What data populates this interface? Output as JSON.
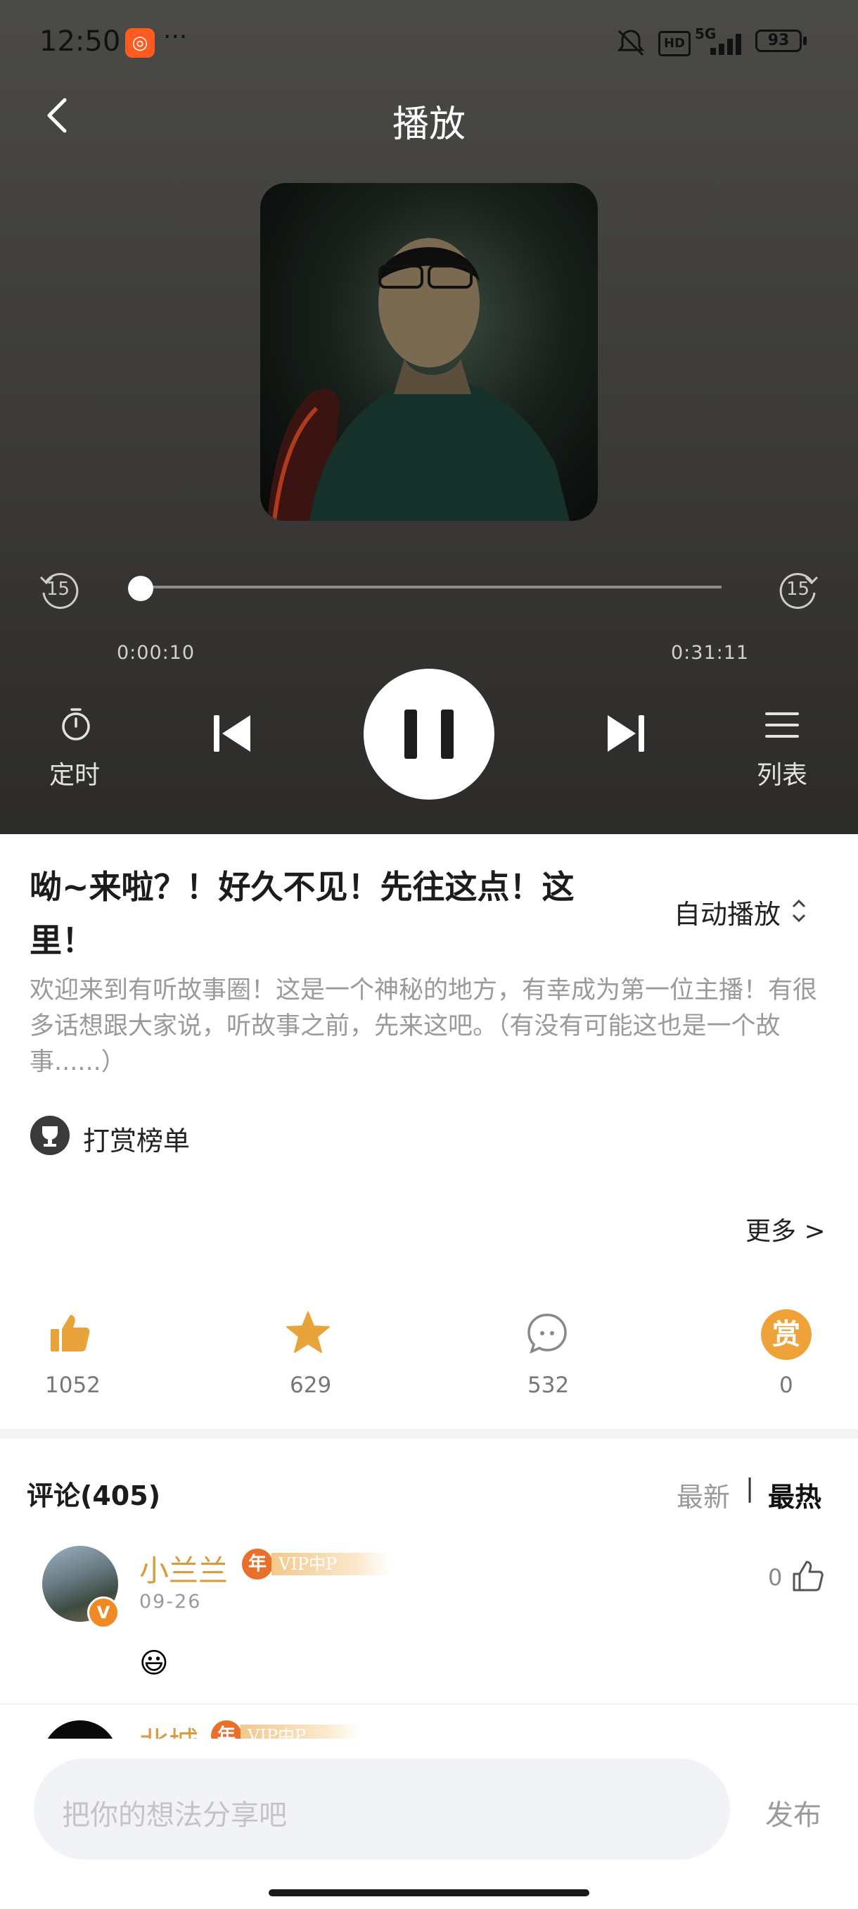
{
  "status_bar": {
    "time": "12:50",
    "ellipsis": "···",
    "battery": "93",
    "network": "5G",
    "hd": "HD"
  },
  "header": {
    "title": "播放"
  },
  "player": {
    "current_time": "0:00:10",
    "total_time": "0:31:11",
    "progress": 0.005,
    "rewind_label": "15",
    "forward_label": "15",
    "timer_label": "定时",
    "list_label": "列表"
  },
  "episode": {
    "title": "呦~来啦？！好久不见！先往这点！这里！",
    "autoplay_label": "自动播放",
    "description": "欢迎来到有听故事圈！这是一个神秘的地方，有幸成为第一位主播！有很多话想跟大家说，听故事之前，先来这吧。（有没有可能这也是一个故事......）",
    "reward_board_label": "打赏榜单",
    "more_label": "更多 >"
  },
  "stats": {
    "likes": "1052",
    "favorites": "629",
    "comments": "532",
    "rewards": "0",
    "reward_icon_text": "赏"
  },
  "comments": {
    "header": "评论(405)",
    "sort_newest": "最新",
    "sort_separator": "|",
    "sort_hottest": "最热",
    "items": [
      {
        "username": "小兰兰",
        "year_badge": "年",
        "vip_badge": "VIP中P",
        "date": "09-26",
        "like_count": "0",
        "content": "😃",
        "verified": "V"
      },
      {
        "username": "北城",
        "year_badge": "年",
        "vip_badge": "VIP中P"
      }
    ]
  },
  "composer": {
    "placeholder": "把你的想法分享吧",
    "publish_label": "发布"
  },
  "colors": {
    "accent": "#e8a33a",
    "orange": "#f08a24",
    "username": "#d99b3c"
  }
}
